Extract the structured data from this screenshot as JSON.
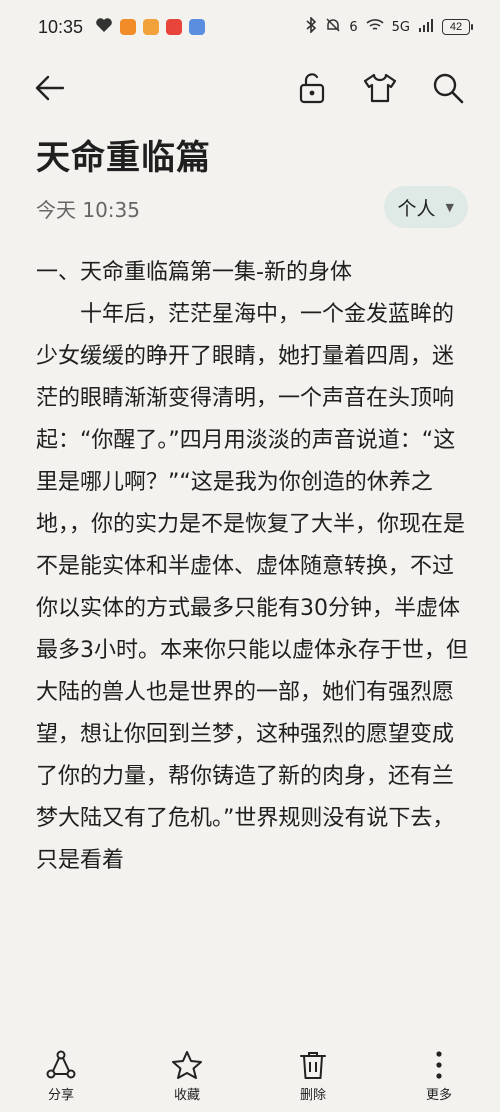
{
  "status_bar": {
    "time": "10:35",
    "network": "5G",
    "signal_label": "6",
    "battery": "42"
  },
  "toolbar": {
    "icons": [
      "back-arrow-icon",
      "unlock-icon",
      "tshirt-icon",
      "search-icon"
    ]
  },
  "note": {
    "title": "天命重临篇",
    "date": "今天 10:35",
    "folder": "个人",
    "paragraphs": [
      "一、天命重临篇第一集-新的身体",
      "十年后，茫茫星海中，一个金发蓝眸的少女缓缓的睁开了眼睛，她打量着四周，迷茫的眼睛渐渐变得清明，一个声音在头顶响起：“你醒了。”四月用淡淡的声音说道：“这里是哪儿啊？”“这是我为你创造的休养之地，，你的实力是不是恢复了大半，你现在是不是能实体和半虚体、虚体随意转换，不过你以实体的方式最多只能有30分钟，半虚体最多3小时。本来你只能以虚体永存于世，但大陆的兽人也是世界的一部，她们有强烈愿望，想让你回到兰梦，这种强烈的愿望变成了你的力量，帮你铸造了新的肉身，还有兰梦大陆又有了危机。”世界规则没有说下去，只是看着"
    ]
  },
  "bottom_bar": {
    "share": "分享",
    "favorite": "收藏",
    "delete": "删除",
    "more": "更多"
  },
  "colors": {
    "background": "#f3f2ee",
    "tag_bg": "#dfe9e5",
    "text": "#1f1f1f"
  }
}
